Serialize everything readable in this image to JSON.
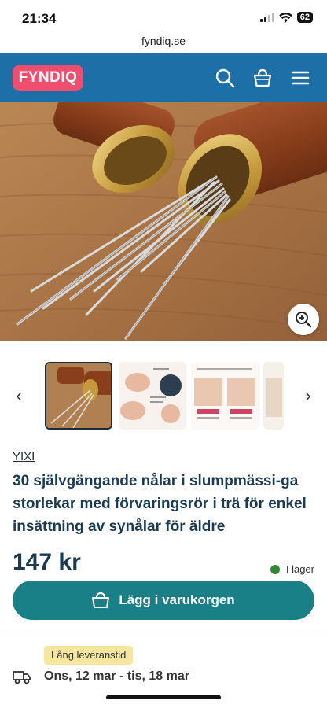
{
  "status": {
    "time": "21:34",
    "battery": "62"
  },
  "browser": {
    "url": "fyndiq.se"
  },
  "header": {
    "logo": "FYNDIQ"
  },
  "product": {
    "brand": "YIXI",
    "title": "30 självgängande nålar i slumpmässi-ga storlekar med förvaringsrör i trä för enkel insättning av synålar för äldre",
    "price": "147 kr",
    "stock": "I lager",
    "add_to_cart": "Lägg i varukorgen"
  },
  "delivery": {
    "badge": "Lång leveranstid",
    "dates": "Ons, 12 mar - tis, 18 mar"
  },
  "colors": {
    "header": "#1d6fa8",
    "logo": "#ef4e6e",
    "cart_button": "#1a8087",
    "badge": "#f7e6a0",
    "stock_dot": "#2e8b3a"
  }
}
